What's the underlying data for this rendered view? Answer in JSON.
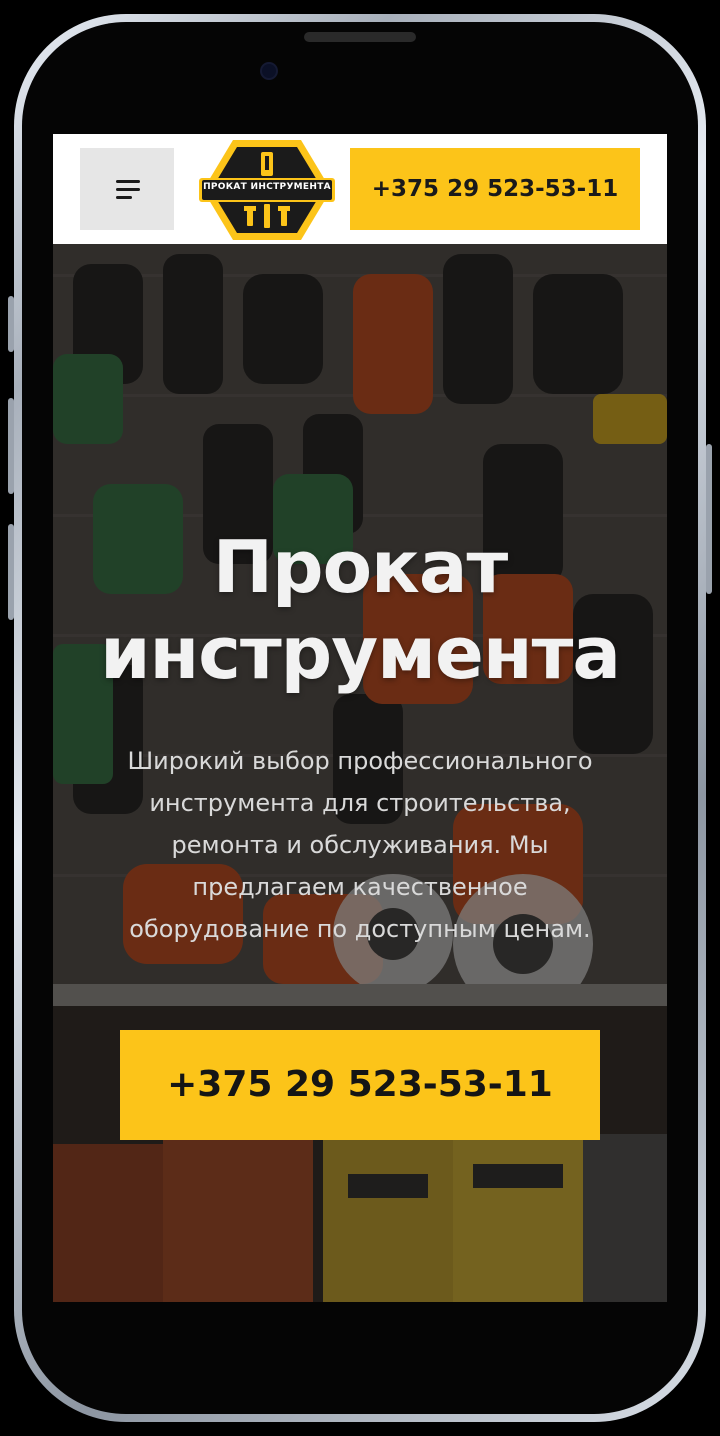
{
  "header": {
    "logo_text": "ПРОКАТ ИНСТРУМЕНТА",
    "phone": "+375 29 523-53-11"
  },
  "hero": {
    "title_line1": "Прокат",
    "title_line2": "инструмента",
    "description_lines": [
      "Широкий выбор профессионального",
      "инструмента для строительства,",
      "ремонта и обслуживания. Мы",
      "предлагаем качественное",
      "оборудование по доступным ценам."
    ],
    "cta_phone": "+375 29 523-53-11"
  },
  "colors": {
    "accent": "#fcc419",
    "header_bg": "#ffffff",
    "menu_button_bg": "#e6e6e6",
    "text_light": "#f2f2f2"
  },
  "icons": {
    "menu": "hamburger-menu-icon",
    "logo": "hexagon-tools-logo-icon"
  }
}
